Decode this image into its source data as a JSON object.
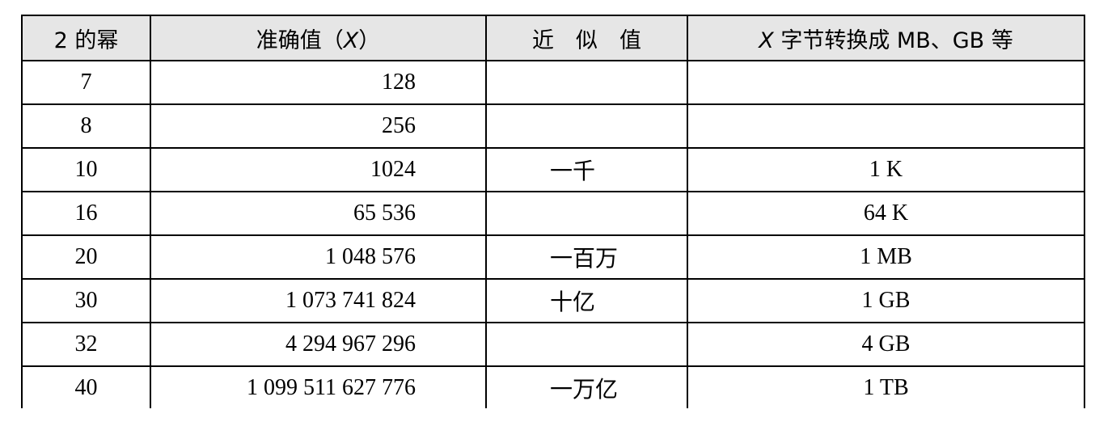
{
  "table": {
    "headers": {
      "power": "2 的幂",
      "exact_prefix": "准确值（",
      "exact_var": "X",
      "exact_suffix": "）",
      "approx": "近　似　值",
      "bytes_var": "X",
      "bytes_rest": " 字节转换成 MB、GB 等"
    },
    "rows": [
      {
        "power": "7",
        "exact": "128",
        "approx": "",
        "bytes": ""
      },
      {
        "power": "8",
        "exact": "256",
        "approx": "",
        "bytes": ""
      },
      {
        "power": "10",
        "exact": "1024",
        "approx": "一千",
        "bytes": "1 K"
      },
      {
        "power": "16",
        "exact": "65 536",
        "approx": "",
        "bytes": "64 K"
      },
      {
        "power": "20",
        "exact": "1 048 576",
        "approx": "一百万",
        "bytes": "1 MB"
      },
      {
        "power": "30",
        "exact": "1 073 741 824",
        "approx": "十亿",
        "bytes": "1 GB"
      },
      {
        "power": "32",
        "exact": "4 294 967 296",
        "approx": "",
        "bytes": "4 GB"
      },
      {
        "power": "40",
        "exact": "1 099 511 627 776",
        "approx": "一万亿",
        "bytes": "1 TB"
      }
    ]
  }
}
